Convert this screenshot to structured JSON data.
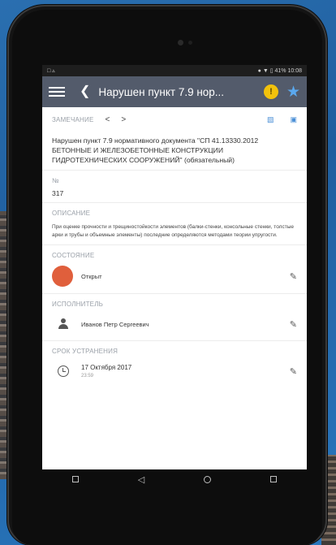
{
  "statusbar": {
    "left": "□ ▵",
    "right": "● ▼ ▯ 41% 10:08"
  },
  "appbar": {
    "title": "Нарушен пункт 7.9 нор...",
    "warn": "!"
  },
  "remark": {
    "label": "ЗАМЕЧАНИЕ",
    "prev": "<",
    "next": ">",
    "text": "Нарушен пункт 7.9 нормативного документа \"СП 41.13330.2012 БЕТОННЫЕ И ЖЕЛЕЗОБЕТОННЫЕ КОНСТРУКЦИИ ГИДРОТЕХНИЧЕСКИХ СООРУЖЕНИЙ\" (обязательный)"
  },
  "number": {
    "label": "№",
    "value": "317"
  },
  "description": {
    "label": "ОПИСАНИЕ",
    "text": "При оценке прочности и трещиностойкости элементов (балки-стенки, консольные стенки, толстые арки и трубы и объемные элементы) последние определяются методами теории упругости."
  },
  "state": {
    "label": "СОСТОЯНИЕ",
    "value": "Открыт",
    "color": "#e05f3c"
  },
  "assignee": {
    "label": "ИСПОЛНИТЕЛЬ",
    "value": "Иванов Петр Сергеевич"
  },
  "deadline": {
    "label": "СРОК УСТРАНЕНИЯ",
    "date": "17 Октября 2017",
    "time": "23:59"
  },
  "colors": {
    "appbar": "#535b6b",
    "accent": "#4a8fd6",
    "warn": "#f2c20c",
    "star": "#5aa8ee"
  }
}
